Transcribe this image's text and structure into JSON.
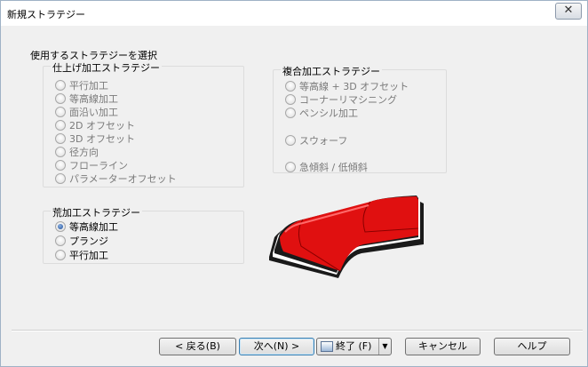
{
  "window": {
    "title": "新規ストラテジー",
    "close_glyph": "✕"
  },
  "section_label": "使用するストラテジーを選択",
  "finishing": {
    "title": "仕上げ加工ストラテジー",
    "options": [
      "平行加工",
      "等高線加工",
      "面沿い加工",
      "2D オフセット",
      "3D オフセット",
      "径方向",
      "フローライン",
      "パラメーターオフセット"
    ]
  },
  "combined": {
    "title": "複合加工ストラテジー",
    "options": [
      "等高線 + 3D オフセット",
      "コーナーリマシニング",
      "ペンシル加工",
      "スウォーフ",
      "急傾斜 / 低傾斜"
    ]
  },
  "roughing": {
    "title": "荒加工ストラテジー",
    "options": [
      "等高線加工",
      "プランジ",
      "平行加工"
    ],
    "selected": "等高線加工"
  },
  "buttons": {
    "back": "< 戻る(B)",
    "next": "次へ(N) >",
    "finish": "終了 (F)",
    "cancel": "キャンセル",
    "help": "ヘルプ"
  },
  "colors": {
    "shape_red": "#e01010",
    "selected_radio": "#1f4f9a"
  }
}
